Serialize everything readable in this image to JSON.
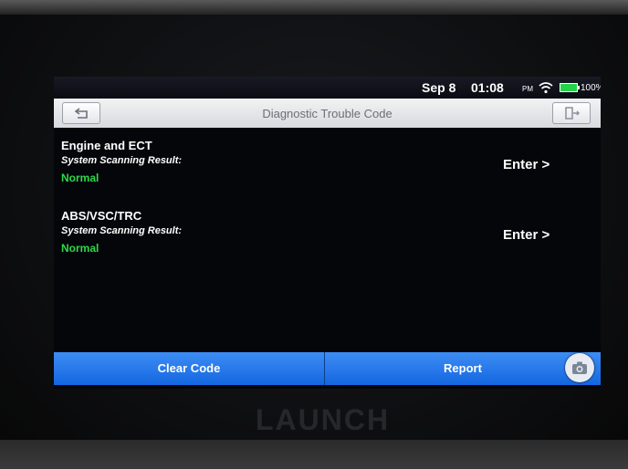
{
  "status_bar": {
    "date": "Sep 8",
    "time": "01:08",
    "ampm": "PM",
    "battery": "100%",
    "icons": [
      "wifi-icon",
      "battery-icon"
    ],
    "battery_color": "#25d34a"
  },
  "header": {
    "title": "Diagnostic Trouble Code",
    "back_icon": "back-arrow-icon",
    "exit_icon": "exit-icon"
  },
  "systems": [
    {
      "name": "Engine and ECT",
      "scan_label": "System Scanning Result:",
      "status": "Normal",
      "enter_label": "Enter >"
    },
    {
      "name": "ABS/VSC/TRC",
      "scan_label": "System Scanning Result:",
      "status": "Normal",
      "enter_label": "Enter >"
    }
  ],
  "footer": {
    "clear_code_label": "Clear Code",
    "report_label": "Report",
    "camera_icon": "camera-icon",
    "accent_color": "#1466e0"
  },
  "device": {
    "brand": "LAUNCH"
  }
}
